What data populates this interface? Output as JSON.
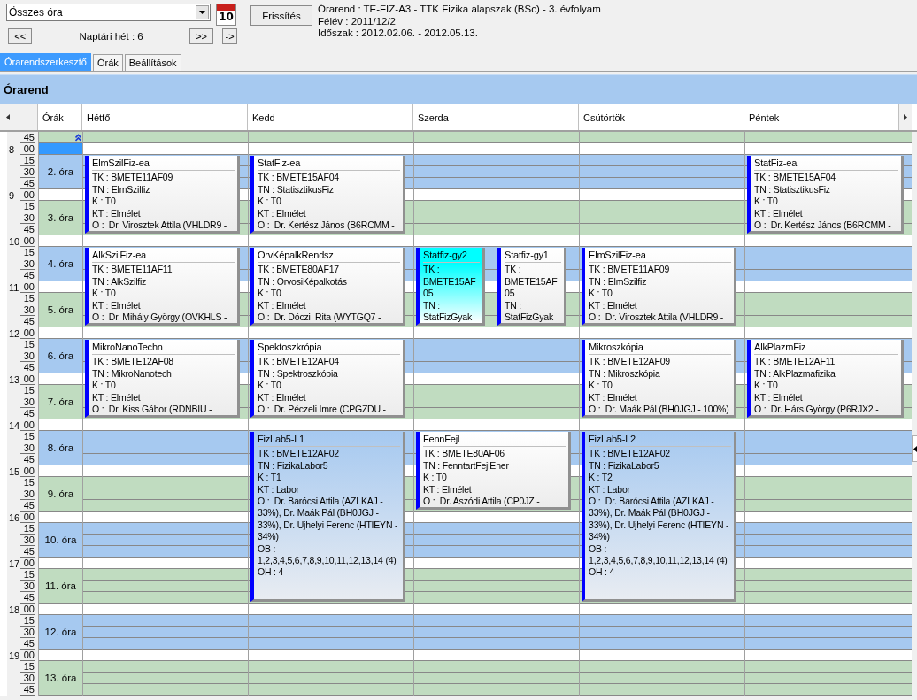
{
  "filter": {
    "value": "Összes óra"
  },
  "calendar_icon": {
    "day": "10"
  },
  "nav": {
    "prev": "<<",
    "week_label": "Naptári hét : 6",
    "next": ">>",
    "jump": "->"
  },
  "refresh_button": "Frissítés",
  "info": [
    "Órarend : TE-FIZ-A3 - TTK Fizika alapszak (BSc) - 3. évfolyam",
    "Félév : 2011/12/2",
    "Időszak : 2012.02.06. - 2012.05.13."
  ],
  "tabs": [
    {
      "label": "Órarendszerkesztő",
      "selected": true
    },
    {
      "label": "Órák",
      "selected": false
    },
    {
      "label": "Beállítások",
      "selected": false
    }
  ],
  "panel_title": "Órarend",
  "periods_column": "Órák",
  "time_rows": [
    {
      "minute": "45",
      "selected": false
    },
    {
      "hour": "8",
      "minute": "00",
      "selected": true
    },
    {
      "minute": "15",
      "selected": false
    },
    {
      "minute": "30",
      "selected": false
    },
    {
      "minute": "45",
      "selected": false
    },
    {
      "hour": "9",
      "minute": "00",
      "selected": false
    },
    {
      "minute": "15",
      "selected": false
    },
    {
      "minute": "30",
      "selected": false
    },
    {
      "minute": "45",
      "selected": false
    },
    {
      "hour": "10",
      "minute": "00",
      "selected": false
    },
    {
      "minute": "15",
      "selected": false
    },
    {
      "minute": "30",
      "selected": false
    },
    {
      "minute": "45",
      "selected": false
    },
    {
      "hour": "11",
      "minute": "00",
      "selected": false
    },
    {
      "minute": "15",
      "selected": false
    },
    {
      "minute": "30",
      "selected": false
    },
    {
      "minute": "45",
      "selected": false
    },
    {
      "hour": "12",
      "minute": "00",
      "selected": false
    },
    {
      "minute": "15",
      "selected": false
    },
    {
      "minute": "30",
      "selected": false
    },
    {
      "minute": "45",
      "selected": false
    },
    {
      "hour": "13",
      "minute": "00",
      "selected": false
    },
    {
      "minute": "15",
      "selected": false
    },
    {
      "minute": "30",
      "selected": false
    },
    {
      "minute": "45",
      "selected": false
    },
    {
      "hour": "14",
      "minute": "00",
      "selected": false
    },
    {
      "minute": "15",
      "selected": false
    },
    {
      "minute": "30",
      "selected": false
    },
    {
      "minute": "45",
      "selected": false
    },
    {
      "hour": "15",
      "minute": "00",
      "selected": false
    },
    {
      "minute": "15",
      "selected": false
    },
    {
      "minute": "30",
      "selected": false
    },
    {
      "minute": "45",
      "selected": false
    },
    {
      "hour": "16",
      "minute": "00",
      "selected": false
    },
    {
      "minute": "15",
      "selected": false
    },
    {
      "minute": "30",
      "selected": false
    },
    {
      "minute": "45",
      "selected": false
    },
    {
      "hour": "17",
      "minute": "00",
      "selected": false
    },
    {
      "minute": "15",
      "selected": false
    },
    {
      "minute": "30",
      "selected": false
    },
    {
      "minute": "45",
      "selected": false
    },
    {
      "hour": "18",
      "minute": "00",
      "selected": false
    },
    {
      "minute": "15",
      "selected": false
    },
    {
      "minute": "30",
      "selected": false
    },
    {
      "minute": "45",
      "selected": false
    },
    {
      "hour": "19",
      "minute": "00",
      "selected": false
    },
    {
      "minute": "15",
      "selected": false
    },
    {
      "minute": "30",
      "selected": false
    },
    {
      "minute": "45",
      "selected": false
    }
  ],
  "periods": [
    {
      "label": "2. óra"
    },
    {
      "label": "3. óra"
    },
    {
      "label": "4. óra"
    },
    {
      "label": "5. óra"
    },
    {
      "label": "6. óra"
    },
    {
      "label": "7. óra"
    },
    {
      "label": "8. óra"
    },
    {
      "label": "9. óra"
    },
    {
      "label": "10. óra"
    },
    {
      "label": "11. óra"
    },
    {
      "label": "12. óra"
    },
    {
      "label": "13. óra"
    }
  ],
  "days": [
    {
      "name": "Hétfő",
      "events": {
        "period_2": [
          {
            "title": "ElmSzilFiz-ea",
            "kind": "double",
            "selected": false,
            "lines": [
              "TK : BMETE11AF09",
              "TN : ElmSzilfiz",
              "K : T0",
              "KT : Elmélet",
              "O :  Dr. Virosztek Attila (VHLDR9 -"
            ]
          }
        ],
        "period_4": [
          {
            "title": "AlkSzilFiz-ea",
            "kind": "double",
            "selected": false,
            "lines": [
              "TK : BMETE11AF11",
              "TN : AlkSzilfiz",
              "K : T0",
              "KT : Elmélet",
              "O :  Dr. Mihály György (OVKHLS -"
            ]
          }
        ],
        "period_6": [
          {
            "title": "MikroNanoTechn",
            "kind": "double",
            "selected": false,
            "lines": [
              "TK : BMETE12AF08",
              "TN : MikroNanotech",
              "K : T0",
              "KT : Elmélet",
              "O :  Dr. Kiss Gábor (RDNBIU -"
            ]
          }
        ]
      }
    },
    {
      "name": "Kedd",
      "events": {
        "period_2": [
          {
            "title": "StatFiz-ea",
            "kind": "double",
            "selected": false,
            "lines": [
              "TK : BMETE15AF04",
              "TN : StatisztikusFiz",
              "K : T0",
              "KT : Elmélet",
              "O :  Dr. Kertész János (B6RCMM -"
            ]
          }
        ],
        "period_4": [
          {
            "title": "OrvKépalkRendsz",
            "kind": "double",
            "selected": false,
            "lines": [
              "TK : BMETE80AF17",
              "TN : OrvosiKépalkotás",
              "K : T0",
              "KT : Elmélet",
              "O :  Dr. Dóczi  Rita (WYTGQ7 -"
            ]
          }
        ],
        "period_6": [
          {
            "title": "Spektoszkrópia",
            "kind": "double",
            "selected": false,
            "lines": [
              "TK : BMETE12AF04",
              "TN : Spektroszkópia",
              "K : T0",
              "KT : Elmélet",
              "O :  Dr. Péczeli Imre (CPGZDU -"
            ]
          }
        ],
        "period_8": [
          {
            "title": "FizLab5-L1",
            "kind": "lab",
            "selected": false,
            "lines": [
              "TK : BMETE12AF02",
              "TN : FizikaLabor5",
              "K : T1",
              "KT : Labor",
              "O :  Dr. Barócsi Attila (AZLKAJ - 33%), Dr. Maák Pál (BH0JGJ - 33%), Dr. Ujhelyi Ferenc (HTIEYN - 34%)",
              "OB : 1,2,3,4,5,6,7,8,9,10,11,12,13,14 (4)",
              "OH : 4"
            ]
          }
        ]
      }
    },
    {
      "name": "Szerda",
      "events": {
        "period_4": [
          {
            "title": "Statfiz-gy2",
            "kind": "double",
            "selected": true,
            "lines": [
              "TK : BMETE15AF05",
              "TN : StatFizGyak"
            ]
          },
          {
            "title": "Statfiz-gy1",
            "kind": "double",
            "selected": false,
            "lines": [
              "TK : BMETE15AF05",
              "TN : StatFizGyak"
            ]
          }
        ],
        "period_8": [
          {
            "title": "FennFejl",
            "kind": "double",
            "selected": false,
            "lines": [
              "TK : BMETE80AF06",
              "TN : FenntartFejlEner",
              "K : T0",
              "KT : Elmélet",
              "O :  Dr. Aszódi Attila (CP0JZ -"
            ]
          }
        ]
      }
    },
    {
      "name": "Csütörtök",
      "events": {
        "period_4": [
          {
            "title": "ElmSzilFiz-ea",
            "kind": "double",
            "selected": false,
            "lines": [
              "TK : BMETE11AF09",
              "TN : ElmSzilfiz",
              "K : T0",
              "KT : Elmélet",
              "O :  Dr. Virosztek Attila (VHLDR9 -"
            ]
          }
        ],
        "period_6": [
          {
            "title": "Mikroszkópia",
            "kind": "double",
            "selected": false,
            "lines": [
              "TK : BMETE12AF09",
              "TN : Mikroszkópia",
              "K : T0",
              "KT : Elmélet",
              "O :  Dr. Maák Pál (BH0JGJ - 100%)"
            ]
          }
        ],
        "period_8": [
          {
            "title": "FizLab5-L2",
            "kind": "lab",
            "selected": false,
            "lines": [
              "TK : BMETE12AF02",
              "TN : FizikaLabor5",
              "K : T2",
              "KT : Labor",
              "O :  Dr. Barócsi Attila (AZLKAJ - 33%), Dr. Maák Pál (BH0JGJ - 33%), Dr. Ujhelyi Ferenc (HTIEYN - 34%)",
              "OB : 1,2,3,4,5,6,7,8,9,10,11,12,13,14 (4)",
              "OH : 4"
            ]
          }
        ]
      }
    },
    {
      "name": "Péntek",
      "events": {
        "period_2": [
          {
            "title": "StatFiz-ea",
            "kind": "double",
            "selected": false,
            "lines": [
              "TK : BMETE15AF04",
              "TN : StatisztikusFiz",
              "K : T0",
              "KT : Elmélet",
              "O :  Dr. Kertész János (B6RCMM -"
            ]
          }
        ],
        "period_6": [
          {
            "title": "AlkPlazmFiz",
            "kind": "double",
            "selected": false,
            "lines": [
              "TK : BMETE12AF11",
              "TN : AlkPlazmafizika",
              "K : T0",
              "KT : Elmélet",
              "O :  Dr. Hárs György (P6RJX2 -"
            ]
          }
        ]
      }
    }
  ]
}
